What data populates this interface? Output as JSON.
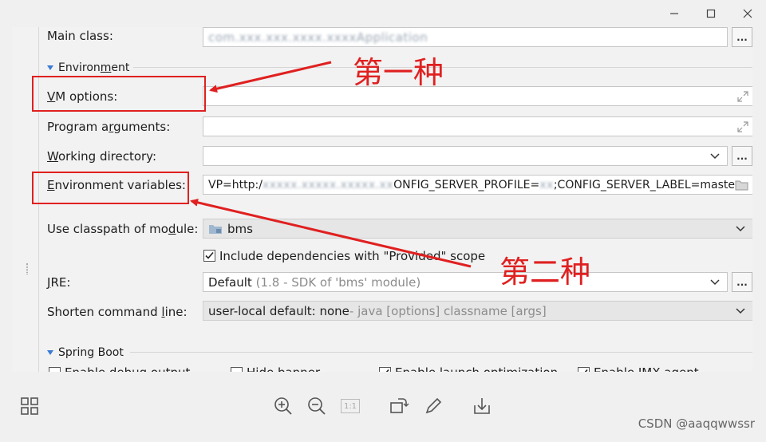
{
  "window": {
    "minimize_icon": "minimize-icon",
    "maximize_icon": "maximize-icon",
    "close_icon": "close-icon"
  },
  "form": {
    "main_class": {
      "label_pre": "Main class:",
      "value": "com.xxx.xxx.xxxx.xxxxApplication"
    },
    "environment_section": {
      "label_pre": "Environ",
      "mnemonic": "m",
      "label_post": "ent"
    },
    "vm_options": {
      "mnemonic": "V",
      "label_post": "M options:",
      "value": ""
    },
    "program_arguments": {
      "label_pre": "Program a",
      "mnemonic": "r",
      "label_post": "guments:",
      "value": ""
    },
    "working_directory": {
      "mnemonic": "W",
      "label_post": "orking directory:",
      "value": ""
    },
    "environment_variables": {
      "mnemonic": "E",
      "label_post": "nvironment variables:",
      "value_pre": "VP=http:/",
      "value_blur": "xxxxx.xxxxx.xxxxx.xx",
      "value_post": "ONFIG_SERVER_PROFILE=",
      "value_blur2": "xx",
      "value_end": ";CONFIG_SERVER_LABEL=master"
    },
    "classpath_module": {
      "label_pre": "Use classpath of mo",
      "mnemonic": "d",
      "label_post": "ule:",
      "value": "bms"
    },
    "include_provided": {
      "label": "Include dependencies with \"Provided\" scope",
      "checked": true
    },
    "jre": {
      "mnemonic": "J",
      "label_post": "RE:",
      "value": "Default",
      "hint": "(1.8 - SDK of 'bms' module)"
    },
    "shorten_cmd": {
      "label_pre": "Shorten command ",
      "mnemonic": "l",
      "label_post": "ine:",
      "value": "user-local default: none",
      "hint": " - java [options] classname [args]"
    },
    "spring_boot_section": {
      "label": "Spring Boot"
    },
    "spring_checkboxes": [
      {
        "label": "Enable debug output",
        "checked": false
      },
      {
        "label": "Hide banner",
        "checked": false
      },
      {
        "label": "Enable launch optimization",
        "checked": true
      },
      {
        "label": "Enable JMX agent",
        "checked": true
      }
    ]
  },
  "annotations": {
    "first": "第一种",
    "second": "第二种",
    "color": "#e02020"
  },
  "toolbar": {
    "grid_icon": "grid-icon",
    "zoom_in_icon": "zoom-in-icon",
    "zoom_out_icon": "zoom-out-icon",
    "actual_size_label": "1:1",
    "rotate_icon": "rotate-icon",
    "edit_icon": "pencil-icon",
    "download_icon": "download-icon"
  },
  "watermark": "CSDN @aaqqwwssr"
}
